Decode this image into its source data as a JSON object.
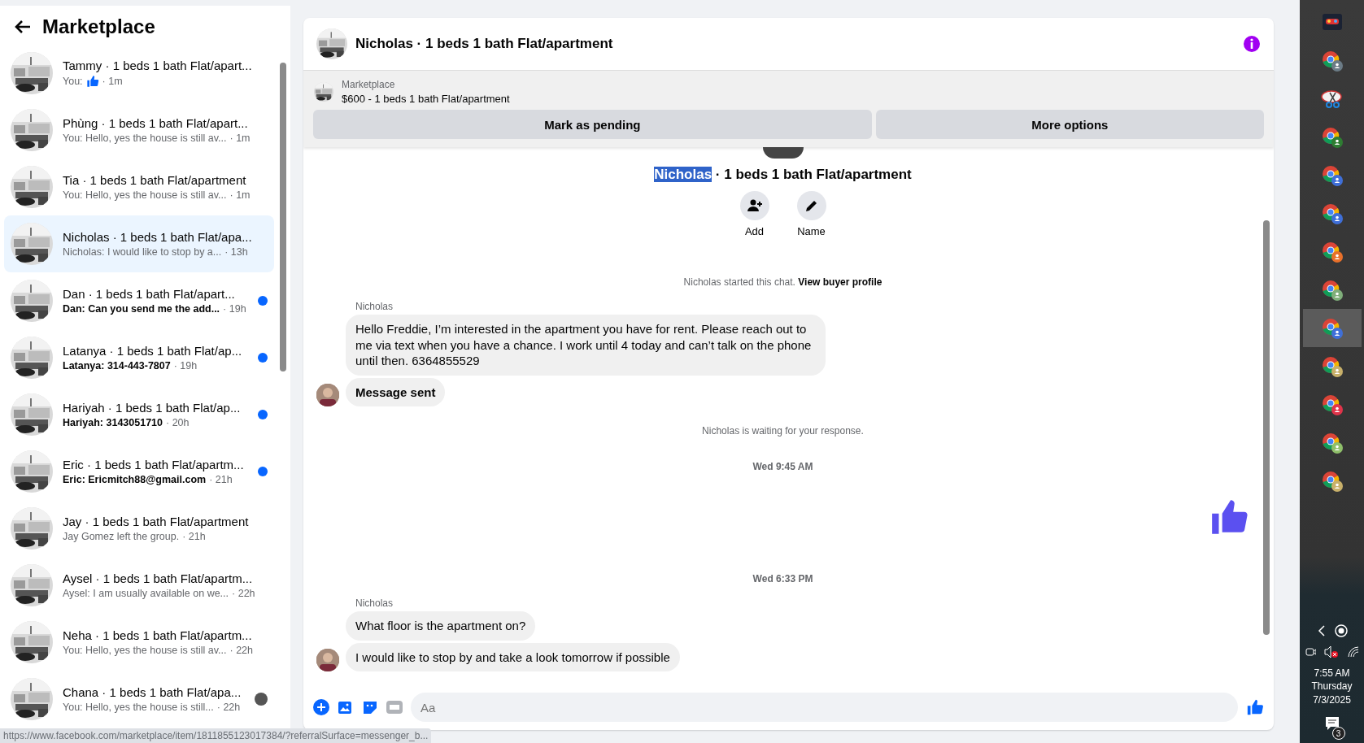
{
  "sidebar": {
    "title": "Marketplace",
    "conversations": [
      {
        "name": "Tammy · 1 beds 1 bath Flat/apart...",
        "preview": "You:",
        "like": true,
        "time": "· 1m",
        "unread": false,
        "selected": false,
        "seen": false
      },
      {
        "name": "Phùng · 1 beds 1 bath Flat/apart...",
        "preview": "You: Hello, yes the house is still av...",
        "like": false,
        "time": "· 1m",
        "unread": false,
        "selected": false,
        "seen": false
      },
      {
        "name": "Tia · 1 beds 1 bath Flat/apartment",
        "preview": "You: Hello, yes the house is still av...",
        "like": false,
        "time": "· 1m",
        "unread": false,
        "selected": false,
        "seen": false
      },
      {
        "name": "Nicholas · 1 beds 1 bath Flat/apa...",
        "preview": "Nicholas: I would like to stop by a...",
        "like": false,
        "time": "· 13h",
        "unread": false,
        "selected": true,
        "seen": false
      },
      {
        "name": "Dan · 1 beds 1 bath Flat/apart...",
        "preview": "Dan: Can you send me the add...",
        "like": false,
        "time": "· 19h",
        "unread": true,
        "selected": false,
        "seen": false
      },
      {
        "name": "Latanya · 1 beds 1 bath Flat/ap...",
        "preview": "Latanya: 314-443-7807",
        "like": false,
        "time": "· 19h",
        "unread": true,
        "selected": false,
        "seen": false
      },
      {
        "name": "Hariyah · 1 beds 1 bath Flat/ap...",
        "preview": "Hariyah: 3143051710",
        "like": false,
        "time": "· 20h",
        "unread": true,
        "selected": false,
        "seen": false
      },
      {
        "name": "Eric · 1 beds 1 bath Flat/apartm...",
        "preview": "Eric: Ericmitch88@gmail.com",
        "like": false,
        "time": "· 21h",
        "unread": true,
        "selected": false,
        "seen": false
      },
      {
        "name": "Jay · 1 beds 1 bath Flat/apartment",
        "preview": "Jay Gomez left the group.",
        "like": false,
        "time": "· 21h",
        "unread": false,
        "selected": false,
        "seen": false
      },
      {
        "name": "Aysel · 1 beds 1 bath Flat/apartm...",
        "preview": "Aysel: I am usually available on we...",
        "like": false,
        "time": "· 22h",
        "unread": false,
        "selected": false,
        "seen": false
      },
      {
        "name": "Neha · 1 beds 1 bath Flat/apartm...",
        "preview": "You: Hello, yes the house is still av...",
        "like": false,
        "time": "· 22h",
        "unread": false,
        "selected": false,
        "seen": false
      },
      {
        "name": "Chana · 1 beds 1 bath Flat/apa...",
        "preview": "You: Hello, yes the house is still...",
        "like": false,
        "time": "· 22h",
        "unread": false,
        "selected": false,
        "seen": true
      }
    ]
  },
  "chat": {
    "title": "Nicholas · 1 beds 1 bath Flat/apartment",
    "listing": {
      "source": "Marketplace",
      "summary": "$600 - 1 beds 1 bath Flat/apartment"
    },
    "actions": [
      "Mark as pending",
      "More options"
    ],
    "intro": {
      "name_highlight": "Nicholas",
      "name_rest": " · 1 beds 1 bath Flat/apartment",
      "buttons": [
        {
          "kind": "add",
          "label": "Add"
        },
        {
          "kind": "name",
          "label": "Name"
        }
      ]
    },
    "messages": [
      {
        "kind": "system",
        "text": "Nicholas started this chat.",
        "link": "View buyer profile"
      },
      {
        "kind": "sender",
        "text": "Nicholas"
      },
      {
        "kind": "bubble",
        "text": "Hello Freddie, I’m interested in the apartment you have for rent. Please reach out to me via text when you have a chance. I work until 4 today and can’t talk on the phone until then. 6364855529",
        "avatar": false,
        "bold": false
      },
      {
        "kind": "bubble",
        "text": "Message sent",
        "avatar": true,
        "bold": true
      },
      {
        "kind": "system",
        "text": "Nicholas is waiting for your response."
      },
      {
        "kind": "timestamp",
        "text": "Wed 9:45 AM"
      },
      {
        "kind": "like"
      },
      {
        "kind": "timestamp",
        "text": "Wed 6:33 PM"
      },
      {
        "kind": "sender",
        "text": "Nicholas"
      },
      {
        "kind": "bubble",
        "text": "What floor is the apartment on?",
        "avatar": false,
        "bold": false
      },
      {
        "kind": "bubble",
        "text": "I would like to stop by and take a look tomorrow if possible",
        "avatar": true,
        "bold": false
      }
    ],
    "composer": {
      "placeholder": "Aa"
    }
  },
  "status_url": "https://www.facebook.com/marketplace/item/1811855123017384/?referralSurface=messenger_b...",
  "taskbar": {
    "apps": [
      {
        "kind": "game",
        "selected": false
      },
      {
        "kind": "chrome",
        "color": "#6b7b86",
        "selected": false
      },
      {
        "kind": "snip",
        "selected": false
      },
      {
        "kind": "chrome",
        "color": "#2e7d32",
        "selected": false
      },
      {
        "kind": "chrome",
        "color": "#3f6fd8",
        "selected": false
      },
      {
        "kind": "chrome",
        "color": "#3f6fd8",
        "selected": false
      },
      {
        "kind": "chrome",
        "color": "#e8702a",
        "selected": false
      },
      {
        "kind": "chrome",
        "color": "#7fae7a",
        "selected": false
      },
      {
        "kind": "chrome",
        "color": "#3f6fd8",
        "selected": true
      },
      {
        "kind": "chrome",
        "color": "#c8b06a",
        "selected": false
      },
      {
        "kind": "chrome",
        "color": "#e0344a",
        "selected": false
      },
      {
        "kind": "chrome",
        "color": "#8fbf6a",
        "selected": false
      },
      {
        "kind": "chrome",
        "color": "#c8b06a",
        "selected": false
      }
    ],
    "time": "7:55 AM",
    "day": "Thursday",
    "date": "7/3/2025",
    "notifications": "3"
  }
}
